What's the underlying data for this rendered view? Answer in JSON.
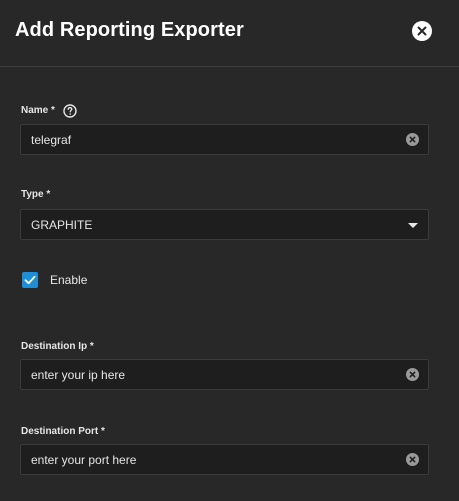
{
  "dialog": {
    "title": "Add Reporting Exporter"
  },
  "fields": {
    "name": {
      "label": "Name *",
      "value": "telegraf"
    },
    "type": {
      "label": "Type *",
      "value": "GRAPHITE"
    },
    "enable": {
      "label": "Enable",
      "checked": true
    },
    "destination_ip": {
      "label": "Destination Ip *",
      "value": "enter your ip here"
    },
    "destination_port": {
      "label": "Destination Port *",
      "value": "enter your port here"
    }
  },
  "icons": {
    "close": "close-icon",
    "help": "help-icon",
    "clear": "clear-icon",
    "dropdown": "chevron-down-icon",
    "check": "check-icon"
  },
  "colors": {
    "background": "#282828",
    "input_background": "#1e1e1e",
    "accent": "#1d8fd9"
  }
}
